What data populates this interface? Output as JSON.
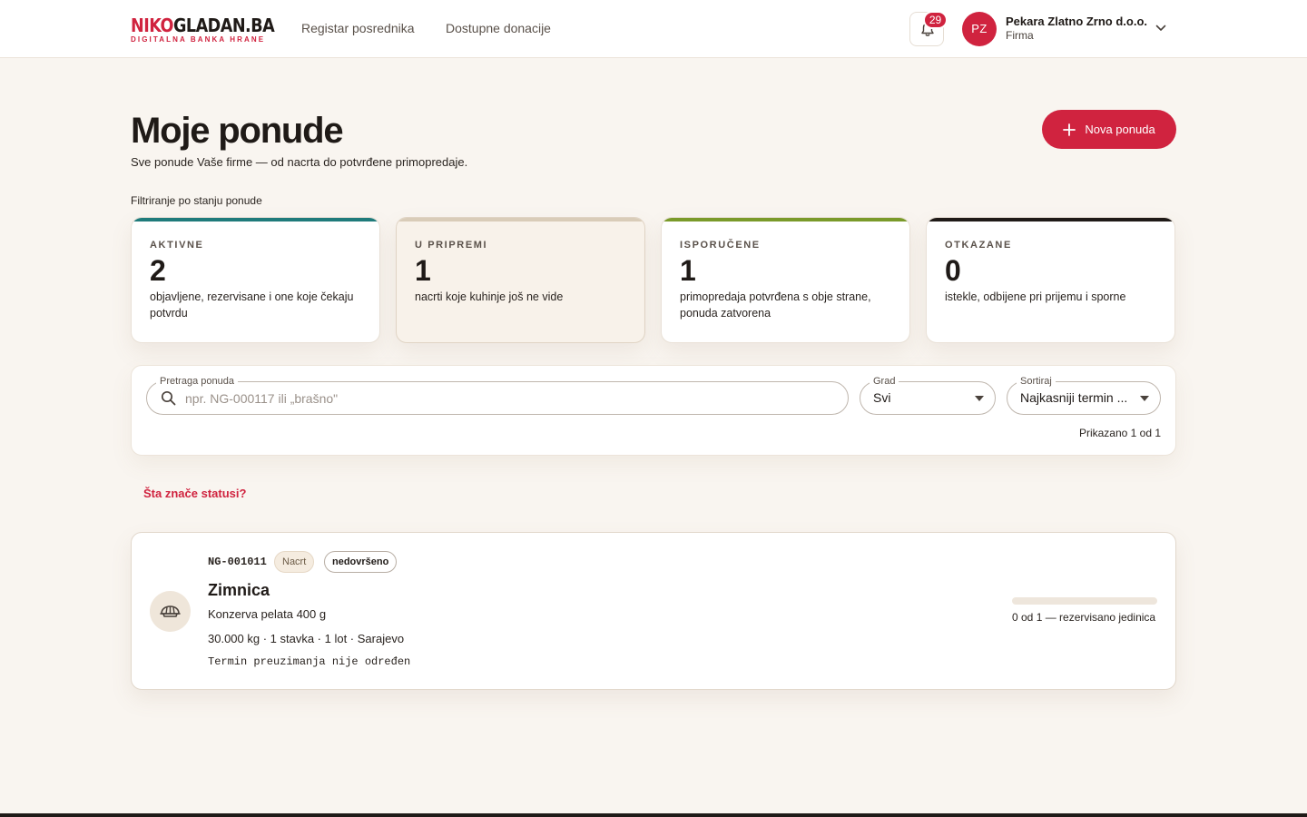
{
  "header": {
    "logo_red": "NIKO",
    "logo_dark": "GLADAN.BA",
    "logo_tagline": "DIGITALNA BANKA HRANE",
    "nav": [
      {
        "label": "Registar posrednika"
      },
      {
        "label": "Dostupne donacije"
      }
    ],
    "notifications_count": "29",
    "user": {
      "initials": "PZ",
      "name": "Pekara Zlatno Zrno d.o.o.",
      "type": "Firma"
    }
  },
  "page": {
    "title": "Moje ponude",
    "subtitle": "Sve ponude Vaše firme — od nacrta do potvrđene primopredaje.",
    "new_button": "Nova ponuda",
    "filter_label": "Filtriranje po stanju ponude"
  },
  "status_cards": [
    {
      "label": "AKTIVNE",
      "count": "2",
      "description": "objavljene, rezervisane i one koje čekaju potvrdu",
      "color": "#1f7b7b"
    },
    {
      "label": "U PRIPREMI",
      "count": "1",
      "description": "nacrti koje kuhinje još ne vide",
      "color": "#d9ccb8"
    },
    {
      "label": "ISPORUČENE",
      "count": "1",
      "description": "primopredaja potvrđena s obje strane, ponuda zatvorena",
      "color": "#7a9a2a"
    },
    {
      "label": "OTKAZANE",
      "count": "0",
      "description": "istekle, odbijene pri prijemu i sporne",
      "color": "#1f1a17"
    }
  ],
  "filters": {
    "search_label": "Pretraga ponuda",
    "search_placeholder": "npr. NG-000117 ili „brašno\"",
    "search_value": "",
    "city_label": "Grad",
    "city_value": "Svi",
    "sort_label": "Sortiraj",
    "sort_value": "Najkasniji termin ...",
    "shown_text": "Prikazano 1 od 1"
  },
  "status_help_link": "Šta znače statusi?",
  "offers": [
    {
      "code": "NG-001011",
      "status_tag": "Nacrt",
      "completeness_tag": "nedovršeno",
      "title": "Zimnica",
      "item": "Konzerva pelata 400 g",
      "details": "30.000 kg · 1 stavka · 1 lot · Sarajevo",
      "pickup": "Termin preuzimanja nije određen",
      "reserved_fraction": 0,
      "reserved_text": "0 od 1 — rezervisano jedinica",
      "icon": "food-bowl-icon"
    }
  ],
  "colors": {
    "brand_red": "#d0233f",
    "background": "#f9f5f0"
  }
}
